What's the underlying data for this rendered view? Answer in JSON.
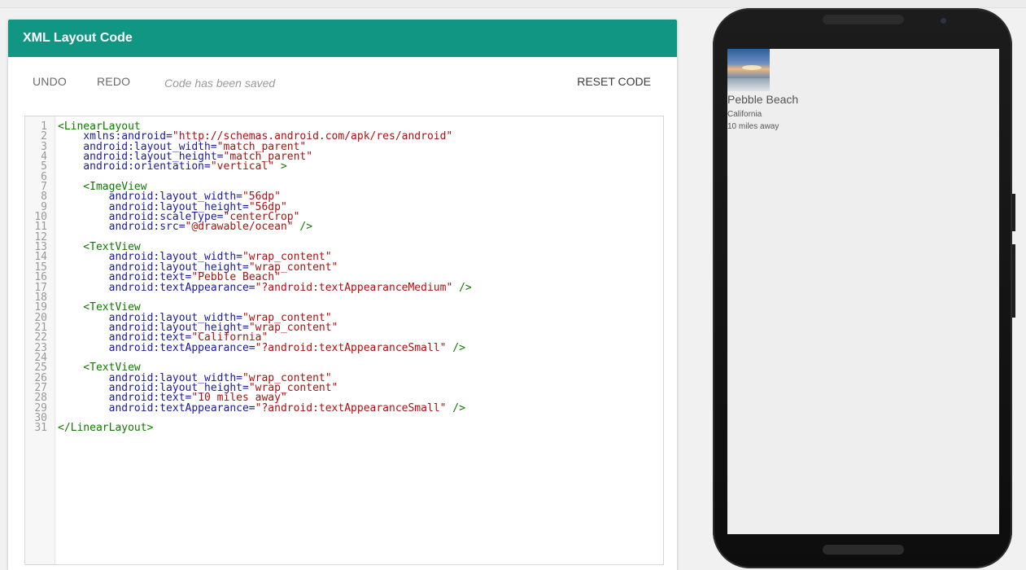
{
  "editor": {
    "title": "XML Layout Code",
    "undo_label": "UNDO",
    "redo_label": "REDO",
    "status_text": "Code has been saved",
    "reset_label": "RESET CODE"
  },
  "code_lines": [
    [
      [
        "tag",
        "<LinearLayout"
      ]
    ],
    [
      [
        "attr",
        "    xmlns:android="
      ],
      [
        "str",
        "\"http://schemas.android.com/apk/res/android\""
      ]
    ],
    [
      [
        "attr",
        "    android:layout_width="
      ],
      [
        "str",
        "\"match_parent\""
      ]
    ],
    [
      [
        "attr",
        "    android:layout_height="
      ],
      [
        "str",
        "\"match_parent\""
      ]
    ],
    [
      [
        "attr",
        "    android:orientation="
      ],
      [
        "str",
        "\"vertical\""
      ],
      [
        "tag",
        " >"
      ]
    ],
    [],
    [
      [
        "tag",
        "    <ImageView"
      ]
    ],
    [
      [
        "attr",
        "        android:layout_width="
      ],
      [
        "str",
        "\"56dp\""
      ]
    ],
    [
      [
        "attr",
        "        android:layout_height="
      ],
      [
        "str",
        "\"56dp\""
      ]
    ],
    [
      [
        "attr",
        "        android:scaleType="
      ],
      [
        "str",
        "\"centerCrop\""
      ]
    ],
    [
      [
        "attr",
        "        android:src="
      ],
      [
        "str",
        "\"@drawable/ocean\""
      ],
      [
        "tag",
        " />"
      ]
    ],
    [],
    [
      [
        "tag",
        "    <TextView"
      ]
    ],
    [
      [
        "attr",
        "        android:layout_width="
      ],
      [
        "str",
        "\"wrap_content\""
      ]
    ],
    [
      [
        "attr",
        "        android:layout_height="
      ],
      [
        "str",
        "\"wrap_content\""
      ]
    ],
    [
      [
        "attr",
        "        android:text="
      ],
      [
        "str",
        "\"Pebble Beach\""
      ]
    ],
    [
      [
        "attr",
        "        android:textAppearance="
      ],
      [
        "str",
        "\"?android:textAppearanceMedium\""
      ],
      [
        "tag",
        " />"
      ]
    ],
    [],
    [
      [
        "tag",
        "    <TextView"
      ]
    ],
    [
      [
        "attr",
        "        android:layout_width="
      ],
      [
        "str",
        "\"wrap_content\""
      ]
    ],
    [
      [
        "attr",
        "        android:layout_height="
      ],
      [
        "str",
        "\"wrap_content\""
      ]
    ],
    [
      [
        "attr",
        "        android:text="
      ],
      [
        "str",
        "\"California\""
      ]
    ],
    [
      [
        "attr",
        "        android:textAppearance="
      ],
      [
        "str",
        "\"?android:textAppearanceSmall\""
      ],
      [
        "tag",
        " />"
      ]
    ],
    [],
    [
      [
        "tag",
        "    <TextView"
      ]
    ],
    [
      [
        "attr",
        "        android:layout_width="
      ],
      [
        "str",
        "\"wrap_content\""
      ]
    ],
    [
      [
        "attr",
        "        android:layout_height="
      ],
      [
        "str",
        "\"wrap_content\""
      ]
    ],
    [
      [
        "attr",
        "        android:text="
      ],
      [
        "str",
        "\"10 miles away\""
      ]
    ],
    [
      [
        "attr",
        "        android:textAppearance="
      ],
      [
        "str",
        "\"?android:textAppearanceSmall\""
      ],
      [
        "tag",
        " />"
      ]
    ],
    [],
    [
      [
        "tag",
        "</LinearLayout>"
      ]
    ]
  ],
  "preview": {
    "title": "Pebble Beach",
    "subtitle1": "California",
    "subtitle2": "10 miles away",
    "image_name": "ocean-image"
  }
}
